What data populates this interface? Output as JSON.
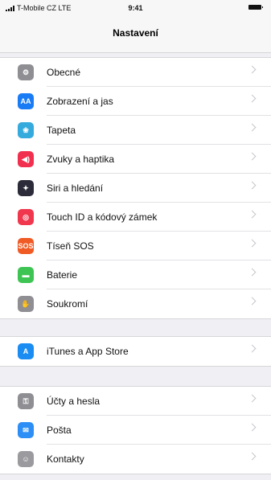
{
  "status": {
    "carrier": "T-Mobile CZ  LTE",
    "time": "9:41"
  },
  "nav": {
    "title": "Nastavení"
  },
  "groups": [
    {
      "items": [
        {
          "label": "Obecné",
          "icon": "gear-icon",
          "color": "#8e8e93",
          "glyph": "⚙"
        },
        {
          "label": "Zobrazení a jas",
          "icon": "text-size-icon",
          "color": "#1a7cf5",
          "glyph": "AA"
        },
        {
          "label": "Tapeta",
          "icon": "wallpaper-icon",
          "color": "#35aadc",
          "glyph": "❀"
        },
        {
          "label": "Zvuky a haptika",
          "icon": "speaker-icon",
          "color": "#f1304f",
          "glyph": "◀)"
        },
        {
          "label": "Siri a hledání",
          "icon": "siri-icon",
          "color": "#2b2b3a",
          "glyph": "✦"
        },
        {
          "label": "Touch ID a kódový zámek",
          "icon": "fingerprint-icon",
          "color": "#f0374d",
          "glyph": "◎"
        },
        {
          "label": "Tíseň SOS",
          "icon": "sos-icon",
          "color": "#f05a24",
          "glyph": "SOS"
        },
        {
          "label": "Baterie",
          "icon": "battery-icon",
          "color": "#3ec453",
          "glyph": "▬"
        },
        {
          "label": "Soukromí",
          "icon": "hand-icon",
          "color": "#8e8e93",
          "glyph": "✋"
        }
      ]
    },
    {
      "items": [
        {
          "label": "iTunes a App Store",
          "icon": "app-store-icon",
          "color": "#1a8cf2",
          "glyph": "A"
        }
      ]
    },
    {
      "items": [
        {
          "label": "Účty a hesla",
          "icon": "key-icon",
          "color": "#8e8e93",
          "glyph": "⚿"
        },
        {
          "label": "Pošta",
          "icon": "mail-icon",
          "color": "#2d8ef5",
          "glyph": "✉"
        },
        {
          "label": "Kontakty",
          "icon": "contacts-icon",
          "color": "#9b9b9f",
          "glyph": "☺"
        }
      ]
    }
  ]
}
